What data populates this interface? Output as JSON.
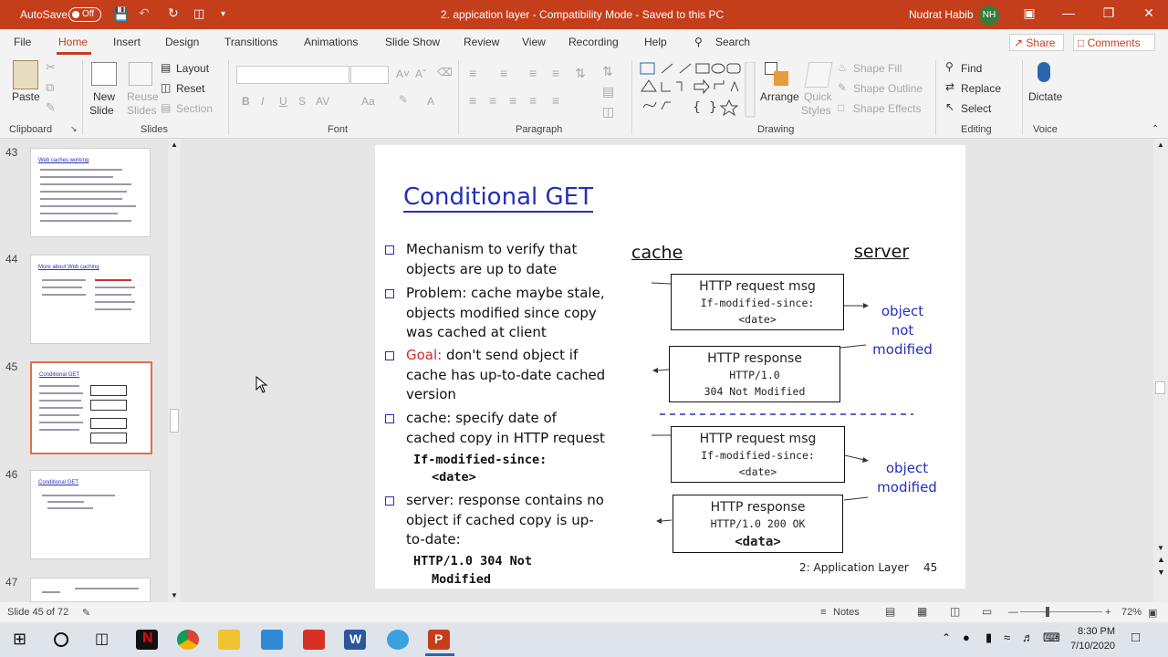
{
  "titlebar": {
    "autosave_label": "AutoSave",
    "autosave_state": "Off",
    "doc_title": "2. appication layer  -  Compatibility Mode  -  Saved to this PC",
    "user_name": "Nudrat Habib",
    "user_initials": "NH"
  },
  "menu": {
    "items": [
      "File",
      "Home",
      "Insert",
      "Design",
      "Transitions",
      "Animations",
      "Slide Show",
      "Review",
      "View",
      "Recording",
      "Help"
    ],
    "active": "Home",
    "search_label": "Search",
    "share_label": "Share",
    "comments_label": "Comments"
  },
  "ribbon": {
    "clipboard": {
      "paste": "Paste",
      "group": "Clipboard"
    },
    "slides": {
      "new_slide_1": "New",
      "new_slide_2": "Slide",
      "reuse_1": "Reuse",
      "reuse_2": "Slides",
      "layout": "Layout",
      "reset": "Reset",
      "section": "Section",
      "group": "Slides"
    },
    "font": {
      "bold": "B",
      "italic": "I",
      "underline": "U",
      "strike": "S",
      "group": "Font"
    },
    "paragraph": {
      "group": "Paragraph"
    },
    "drawing": {
      "arrange": "Arrange",
      "quick_styles_1": "Quick",
      "quick_styles_2": "Styles",
      "shape_fill": "Shape Fill",
      "shape_outline": "Shape Outline",
      "shape_effects": "Shape Effects",
      "group": "Drawing"
    },
    "editing": {
      "find": "Find",
      "replace": "Replace",
      "select": "Select",
      "group": "Editing"
    },
    "voice": {
      "dictate": "Dictate",
      "group": "Voice"
    }
  },
  "thumbnails": [
    {
      "num": "43",
      "title": "Web caches working"
    },
    {
      "num": "44",
      "title": "More about Web caching"
    },
    {
      "num": "45",
      "title": "Conditional GET",
      "selected": true
    },
    {
      "num": "46",
      "title": "Conditional GET"
    },
    {
      "num": "47",
      "title": ""
    }
  ],
  "slide": {
    "title": "Conditional GET",
    "bullets": [
      {
        "lines": [
          "Mechanism to verify that",
          "objects are up to date"
        ]
      },
      {
        "lines": [
          "Problem: cache maybe stale,",
          "objects modified since copy",
          "was cached at client"
        ]
      },
      {
        "highlight": "Goal:",
        "lines": [
          " don't send object if",
          "cache has up-to-date cached",
          "version"
        ]
      },
      {
        "lines": [
          "cache: specify date of",
          "cached copy in HTTP request"
        ],
        "mono": [
          "If-modified-since:",
          "<date>"
        ]
      },
      {
        "lines": [
          "server: response contains no",
          "object if cached copy is up-",
          "to-date:"
        ],
        "mono": [
          "HTTP/1.0 304 Not",
          "Modified"
        ]
      }
    ],
    "cache_label": "cache",
    "server_label": "server",
    "box1": {
      "line1": "HTTP request msg",
      "line2": "If-modified-since:",
      "line3": "<date>"
    },
    "box2": {
      "line1": "HTTP response",
      "line2": "HTTP/1.0",
      "line3": "304 Not Modified"
    },
    "box3": {
      "line1": "HTTP request msg",
      "line2": "If-modified-since:",
      "line3": "<date>"
    },
    "box4": {
      "line1": "HTTP response",
      "line2": "HTTP/1.0 200 OK",
      "line3": "<data>"
    },
    "label_not_modified": [
      "object",
      "not",
      "modified"
    ],
    "label_modified": [
      "object",
      "modified"
    ],
    "footer": "2: Application Layer",
    "page_num": "45"
  },
  "status": {
    "slide_info": "Slide 45 of 72",
    "notes": "Notes",
    "zoom": "72%"
  },
  "taskbar": {
    "time": "8:30 PM",
    "date": "7/10/2020"
  },
  "colors": {
    "accent": "#c43e1c",
    "slide_blue": "#2330b8",
    "goal_red": "#d42a2a"
  }
}
